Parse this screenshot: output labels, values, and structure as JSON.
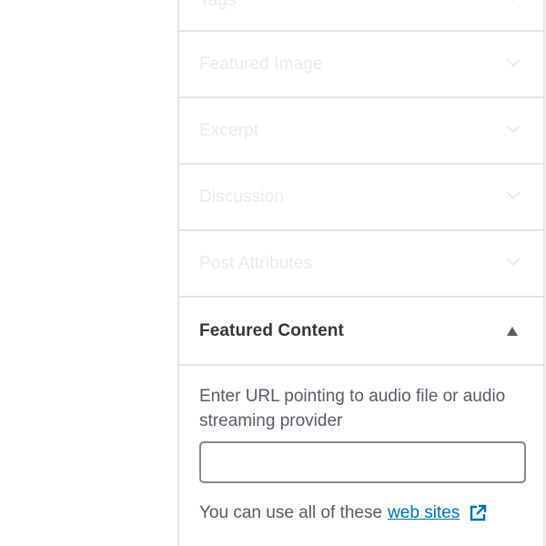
{
  "panels": [
    {
      "id": "tags",
      "label": "Tags"
    },
    {
      "id": "featured-image",
      "label": "Featured Image"
    },
    {
      "id": "excerpt",
      "label": "Excerpt"
    },
    {
      "id": "discussion",
      "label": "Discussion"
    },
    {
      "id": "post-attributes",
      "label": "Post Attributes"
    }
  ],
  "featured_content": {
    "label": "Featured Content",
    "help_text": "Enter URL pointing to audio file or audio streaming provider",
    "url_value": "",
    "sites_prefix": "You can use all of these",
    "sites_link": "web sites",
    "icons": {
      "toggle": "caret-up-icon",
      "link": "external-link-icon"
    }
  },
  "colors": {
    "link": "#0073aa",
    "heading": "#32373c",
    "text": "#555d66",
    "faded": "#e8eaec",
    "border": "#e2e4e7"
  }
}
